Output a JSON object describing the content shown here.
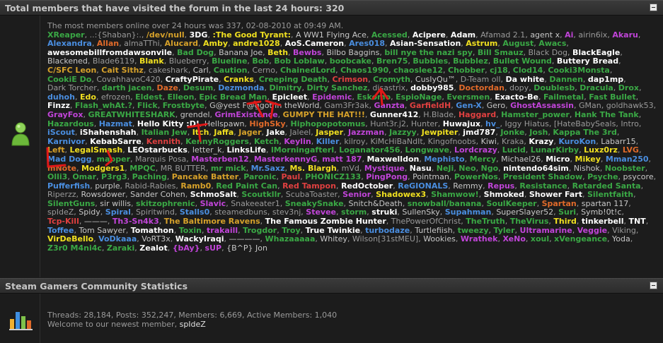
{
  "online_section": {
    "title": "Total members that have visited the forum in the last 24 hours: 320",
    "record_line": "The most members online over 24 hours was 337, 02-08-2010 at 09:49 AM.",
    "members": [
      [
        "XReaper",
        "#3aa845"
      ],
      [
        "..:{Shaban}:.",
        "#9a9a9a"
      ],
      [
        "/dev/null",
        "#d6a12a"
      ],
      [
        "3DG",
        "#ffffff"
      ],
      [
        ":The Good Tyrant:",
        "#f0e020"
      ],
      [
        "A WW1 Flying Ace",
        "#c8c8c8"
      ],
      [
        "Acessed",
        "#3aa845"
      ],
      [
        "Acipere",
        "#ffffff"
      ],
      [
        "Adam",
        "#ffffff"
      ],
      [
        "Afamad 2.1",
        "#9a9a9a"
      ],
      [
        "agent x",
        "#c8c8c8"
      ],
      [
        "Ai",
        "#c044d8"
      ],
      [
        "airin6ix",
        "#9a9a9a"
      ],
      [
        "Akaru",
        "#c044d8"
      ],
      [
        "Alexandra",
        "#4a8ee0"
      ],
      [
        "Allan",
        "#e06a2a"
      ],
      [
        "almaTThi",
        "#9a9a9a"
      ],
      [
        "Alucard",
        "#d6a12a"
      ],
      [
        "Amby",
        "#f0e020"
      ],
      [
        "andre1028",
        "#f0e020"
      ],
      [
        "AoS.Cameron",
        "#ffffff"
      ],
      [
        "Ares018",
        "#4a8ee0"
      ],
      [
        "Asian-Sensation",
        "#ffffff"
      ],
      [
        "Astrum",
        "#f0e020"
      ],
      [
        "August",
        "#3aa845"
      ],
      [
        "Awacs",
        "#3aa845"
      ],
      [
        "awesomebillfromdawsonvile",
        "#ffffff"
      ],
      [
        "Bad Dog",
        "#3aa845"
      ],
      [
        "Banana Joe",
        "#c8c8c8"
      ],
      [
        "Beth",
        "#f0e020"
      ],
      [
        "Bewbs",
        "#c044d8"
      ],
      [
        "Bilbo Baggins",
        "#c8c8c8"
      ],
      [
        "bill nye the nazi spy",
        "#3aa845"
      ],
      [
        "Bill Smauz",
        "#3aa845"
      ],
      [
        "Black Dog",
        "#9a9a9a"
      ],
      [
        "BlackEagle",
        "#ffffff"
      ],
      [
        "Blackened",
        "#c8c8c8"
      ],
      [
        "Blade6119",
        "#9a9a9a"
      ],
      [
        "Blank",
        "#f0e020"
      ],
      [
        "Blueberry",
        "#9a9a9a"
      ],
      [
        "Blueline",
        "#3aa845"
      ],
      [
        "Bob",
        "#3aa845"
      ],
      [
        "Bob Loblaw",
        "#3aa845"
      ],
      [
        "boobcake",
        "#3aa845"
      ],
      [
        "Bren75",
        "#3aa845"
      ],
      [
        "Bubbles",
        "#3aa845"
      ],
      [
        "Bubblez",
        "#3aa845"
      ],
      [
        "Bullet Wound",
        "#3aa845"
      ],
      [
        "Buttery Bread",
        "#ffffff"
      ],
      [
        "C/SFC Leon",
        "#d6a12a"
      ],
      [
        "Cait Sithz",
        "#d6a12a"
      ],
      [
        "cakeshark",
        "#9a9a9a"
      ],
      [
        "Carl",
        "#c8c8c8"
      ],
      [
        "Caution",
        "#3aa845"
      ],
      [
        "Cerno",
        "#9a9a9a"
      ],
      [
        "ChainedLord",
        "#3aa845"
      ],
      [
        "Chaos1990",
        "#3aa845"
      ],
      [
        "chaoslee12",
        "#3aa845"
      ],
      [
        "Chobber",
        "#3aa845"
      ],
      [
        "cj18",
        "#3aa845"
      ],
      [
        "Clod14",
        "#3aa845"
      ],
      [
        "Cooki3Monsta",
        "#3aa845"
      ],
      [
        "CookiE Do",
        "#3aa845"
      ],
      [
        "CovahhavoC420",
        "#9a9a9a"
      ],
      [
        "CraftyPirate",
        "#ffffff"
      ],
      [
        "Cranks",
        "#f0e020"
      ],
      [
        "Creeping Death",
        "#3aa845"
      ],
      [
        "Crimson",
        "#e04040"
      ],
      [
        "Cromyth",
        "#3aa845"
      ],
      [
        "CusIyQu™",
        "#c8c8c8"
      ],
      [
        "D-Team oll",
        "#9a9a9a"
      ],
      [
        "Da white",
        "#ffffff"
      ],
      [
        "Dannen",
        "#3aa845"
      ],
      [
        "dap1mp",
        "#ffffff"
      ],
      [
        "Dark Torcher",
        "#9a9a9a"
      ],
      [
        "darth jacen",
        "#3aa845"
      ],
      [
        "Daze",
        "#e06a2a"
      ],
      [
        "Desum",
        "#3aa845"
      ],
      [
        "Dezmonda",
        "#4a8ee0"
      ],
      [
        "Dimitry",
        "#3aa845"
      ],
      [
        "Dirty Sanchez",
        "#3aa845"
      ],
      [
        "disastrix",
        "#9a9a9a"
      ],
      [
        "dobby985",
        "#ffffff"
      ],
      [
        "Doctordan",
        "#e06a2a"
      ],
      [
        "dopy",
        "#9a9a9a"
      ],
      [
        "Doublesb",
        "#3aa845"
      ],
      [
        "Dracula",
        "#3aa845"
      ],
      [
        "Drox",
        "#3aa845"
      ],
      [
        "duhoh",
        "#4a8ee0"
      ],
      [
        "Edo",
        "#f0e020"
      ],
      [
        "efrozen",
        "#9a9a9a"
      ],
      [
        "Eldest",
        "#3aa845"
      ],
      [
        "Elleon",
        "#3aa845"
      ],
      [
        "Epic Bread Man",
        "#3aa845"
      ],
      [
        "Epicleet",
        "#ffffff"
      ],
      [
        "Epidemic",
        "#c044d8"
      ],
      [
        "Eskomo",
        "#3aa845"
      ],
      [
        "EspioNage",
        "#3aa845"
      ],
      [
        "Eversmen",
        "#3aa845"
      ],
      [
        "Exacto-Be",
        "#ffffff"
      ],
      [
        "Failmetal",
        "#3aa845"
      ],
      [
        "Fast Bullet",
        "#3aa845"
      ],
      [
        "Finzz",
        "#ffffff"
      ],
      [
        "Flash_whAt.?",
        "#3aa845"
      ],
      [
        "Flick",
        "#3aa845"
      ],
      [
        "Frostbyte",
        "#3aa845"
      ],
      [
        "G@yest F@ggot in theWorld",
        "#c8c8c8"
      ],
      [
        "Gam3Fr3ak",
        "#9a9a9a"
      ],
      [
        "Ganzta",
        "#c044d8"
      ],
      [
        "GarfieldH",
        "#e04040"
      ],
      [
        "Gen-X",
        "#4a8ee0"
      ],
      [
        "Gero",
        "#c8c8c8"
      ],
      [
        "GhostAssassin",
        "#c044d8"
      ],
      [
        "GMan",
        "#9a9a9a"
      ],
      [
        "goldhawk53",
        "#9a9a9a"
      ],
      [
        "GrayFox",
        "#c044d8"
      ],
      [
        "GREATWHITESHARK",
        "#3aa845"
      ],
      [
        "grendel",
        "#c8c8c8"
      ],
      [
        "GrimExistence",
        "#c044d8"
      ],
      [
        "GUMPY THE HAT!!!",
        "#d6a12a"
      ],
      [
        "Gunner412",
        "#ffffff"
      ],
      [
        "H.Blade",
        "#9a9a9a"
      ],
      [
        "Haggard",
        "#e04040"
      ],
      [
        "Hamster_power",
        "#3aa845"
      ],
      [
        "Hank The Tank",
        "#3aa845"
      ],
      [
        "Hazardous",
        "#3aa845"
      ],
      [
        "Hazmat",
        "#4a8ee0"
      ],
      [
        "Hello Kitty :D!",
        "#ffffff"
      ],
      [
        "Hellspawn",
        "#c8c8c8"
      ],
      [
        "HighSky",
        "#e06a2a"
      ],
      [
        "Hiphopopotomus",
        "#3aa845"
      ],
      [
        "Hunt3r.j2",
        "#9a9a9a"
      ],
      [
        "Hunter",
        "#9a9a9a"
      ],
      [
        "Huwajux",
        "#ffffff"
      ],
      [
        "hv_",
        "#4a8ee0"
      ],
      [
        "Iggy Hiatus",
        "#9a9a9a"
      ],
      [
        "[HateBabySeals",
        "#9a9a9a"
      ],
      [
        "Intro",
        "#9a9a9a"
      ],
      [
        "iScout",
        "#4a8ee0"
      ],
      [
        "iShahenshah",
        "#ffffff"
      ],
      [
        "Italian Jew",
        "#3aa845"
      ],
      [
        "Itch",
        "#f0e020"
      ],
      [
        "Jaffa",
        "#f0e020"
      ],
      [
        "Jager",
        "#d6a12a"
      ],
      [
        "Jake",
        "#ffffff"
      ],
      [
        "Jaleel",
        "#9a9a9a"
      ],
      [
        "Jasper",
        "#f0e020"
      ],
      [
        "Jazzman",
        "#c044d8"
      ],
      [
        "Jazzyy",
        "#3aa845"
      ],
      [
        "Jewpiter",
        "#f0e020"
      ],
      [
        "jmd787",
        "#ffffff"
      ],
      [
        "Jonke",
        "#3aa845"
      ],
      [
        "Josh",
        "#3aa845"
      ],
      [
        "Kappa The 3rd",
        "#3aa845"
      ],
      [
        "Karnivor",
        "#4a8ee0"
      ],
      [
        "KebabSarre",
        "#ffffff"
      ],
      [
        "Kennith",
        "#e04040"
      ],
      [
        "KennyRoggers",
        "#3aa845"
      ],
      [
        "Ketch",
        "#3aa845"
      ],
      [
        "Keylin",
        "#c044d8"
      ],
      [
        "Killer",
        "#4a8ee0"
      ],
      [
        "kilroy",
        "#9a9a9a"
      ],
      [
        "KiMcHiBaNdIt",
        "#9a9a9a"
      ],
      [
        "Kingofnoobs",
        "#9a9a9a"
      ],
      [
        "Kiwi",
        "#c8c8c8"
      ],
      [
        "Kraka",
        "#9a9a9a"
      ],
      [
        "Krazy",
        "#ffffff"
      ],
      [
        "KuroKon",
        "#4a8ee0"
      ],
      [
        "Labarr15",
        "#c8c8c8"
      ],
      [
        "Left",
        "#d6a12a"
      ],
      [
        "LegalSmash",
        "#f0e020"
      ],
      [
        "LEOstarbucks",
        "#ffffff"
      ],
      [
        "letter_k",
        "#c8c8c8"
      ],
      [
        "LinksLife",
        "#ffffff"
      ],
      [
        "lMorningafterl",
        "#3aa845"
      ],
      [
        "Loganator456",
        "#3aa845"
      ],
      [
        "Longwave",
        "#3aa845"
      ],
      [
        "Lordcrazy",
        "#c044d8"
      ],
      [
        "Lucid",
        "#3aa845"
      ],
      [
        "LunarKirby",
        "#3aa845"
      ],
      [
        "Luxz0rz",
        "#f0e020"
      ],
      [
        "LVG",
        "#e06a2a"
      ],
      [
        "Mad Dogg",
        "#4a8ee0"
      ],
      [
        "mapper",
        "#3aa845"
      ],
      [
        "Marquis Posa",
        "#9a9a9a"
      ],
      [
        "Masterben12",
        "#c044d8"
      ],
      [
        "MasterkennyG",
        "#c044d8"
      ],
      [
        "matt 187",
        "#c044d8"
      ],
      [
        "Maxwelldon",
        "#ffffff"
      ],
      [
        "Mephisto",
        "#4a8ee0"
      ],
      [
        "Mercy",
        "#3aa845"
      ],
      [
        "Michael26",
        "#c8c8c8"
      ],
      [
        "Micro",
        "#ffffff"
      ],
      [
        "Mikey",
        "#f0e020"
      ],
      [
        "Mman250",
        "#4a8ee0"
      ],
      [
        "mNote",
        "#e06a2a"
      ],
      [
        "Modgers1",
        "#f0e020"
      ],
      [
        "MPQC",
        "#3aa845"
      ],
      [
        "MR BUTTER",
        "#9a9a9a"
      ],
      [
        "mr mick",
        "#3aa845"
      ],
      [
        "Mr.Saxz",
        "#4a8ee0"
      ],
      [
        "Ms. Blargh",
        "#f0e020"
      ],
      [
        "mVd",
        "#9a9a9a"
      ],
      [
        "Mystique",
        "#c044d8"
      ],
      [
        "Nasu",
        "#ffffff"
      ],
      [
        "NeJi",
        "#3aa845"
      ],
      [
        "Neo",
        "#3aa845"
      ],
      [
        "Ngo",
        "#3aa845"
      ],
      [
        "nintendo64sim",
        "#ffffff"
      ],
      [
        "Nishok",
        "#c8c8c8"
      ],
      [
        "Noobster",
        "#3aa845"
      ],
      [
        "Olli3",
        "#3aa845"
      ],
      [
        "Omar",
        "#3aa845"
      ],
      [
        "P3rg3",
        "#3aa845"
      ],
      [
        "Paching",
        "#3aa845"
      ],
      [
        "Pancake Batter",
        "#d6a12a"
      ],
      [
        "Paronic",
        "#3aa845"
      ],
      [
        "Paul",
        "#e04040"
      ],
      [
        "PHONICZ133",
        "#3aa845"
      ],
      [
        "PingPong",
        "#c044d8"
      ],
      [
        "Pointman",
        "#c8c8c8"
      ],
      [
        "PowerNos",
        "#3aa845"
      ],
      [
        "President Shadow",
        "#3aa845"
      ],
      [
        "Psyche",
        "#3aa845"
      ],
      [
        "psycore",
        "#c8c8c8"
      ],
      [
        "Pufferfish",
        "#4a8ee0"
      ],
      [
        "purple",
        "#c8c8c8"
      ],
      [
        "Rabid-Rabies",
        "#9a9a9a"
      ],
      [
        "Ramb0",
        "#d6a12a"
      ],
      [
        "Red Paint Can",
        "#3aa845"
      ],
      [
        "Red Tampon",
        "#e04040"
      ],
      [
        "RedOctober",
        "#ffffff"
      ],
      [
        "ReGIONALS",
        "#4a8ee0"
      ],
      [
        "Remmy",
        "#c8c8c8"
      ],
      [
        "Repus",
        "#c044d8"
      ],
      [
        "Resistance",
        "#3aa845"
      ],
      [
        "Retarded Santa",
        "#3aa845"
      ],
      [
        "Riperzz",
        "#9a9a9a"
      ],
      [
        "Rowsdower",
        "#c8c8c8"
      ],
      [
        "Sander Cohen",
        "#c8c8c8"
      ],
      [
        "SchmoSalt",
        "#ffffff"
      ],
      [
        "Scoutkllr",
        "#3aa845"
      ],
      [
        "ScubaToaster",
        "#9a9a9a"
      ],
      [
        "Senior",
        "#c044d8"
      ],
      [
        "Shadowex3",
        "#f0e020"
      ],
      [
        "Shamwow!",
        "#3aa845"
      ],
      [
        "Shmoked",
        "#ffffff"
      ],
      [
        "Shower Fart",
        "#ffffff"
      ],
      [
        "Silentfaith",
        "#3aa845"
      ],
      [
        "SilentGuns",
        "#3aa845"
      ],
      [
        "sir willis",
        "#c8c8c8"
      ],
      [
        "skitzophrenic",
        "#3aa845"
      ],
      [
        "Slavic",
        "#c044d8"
      ],
      [
        "Snakeeater1",
        "#9a9a9a"
      ],
      [
        "SneakySnake",
        "#3aa845"
      ],
      [
        "Snitch&Death",
        "#c8c8c8"
      ],
      [
        "snowball/banana",
        "#3aa845"
      ],
      [
        "SoulKeeper",
        "#3aa845"
      ],
      [
        "Spartan",
        "#e06a2a"
      ],
      [
        "spartan 117",
        "#c8c8c8"
      ],
      [
        "spIdeZ",
        "#9a9a9a"
      ],
      [
        "Spidy",
        "#c8c8c8"
      ],
      [
        "Spiral",
        "#4a8ee0"
      ],
      [
        "Spiritwind",
        "#9a9a9a"
      ],
      [
        "Stalls0",
        "#4a8ee0"
      ],
      [
        "steamedbuns",
        "#9a9a9a"
      ],
      [
        "stev3nj",
        "#9a9a9a"
      ],
      [
        "Stevee",
        "#c044d8"
      ],
      [
        "storm",
        "#3aa845"
      ],
      [
        "struki",
        "#ffffff"
      ],
      [
        "SullenSky",
        "#c8c8c8"
      ],
      [
        "Supahman",
        "#4a8ee0"
      ],
      [
        "SuperSlayer52",
        "#c8c8c8"
      ],
      [
        "Suri",
        "#3aa845"
      ],
      [
        "Symb!0t!c",
        "#c8c8c8"
      ],
      [
        "Tcp-Kill",
        "#e04040"
      ],
      [
        "———",
        "#c8c8c8"
      ],
      [
        "Th3-Sn4k3",
        "#c044d8"
      ],
      [
        "The Baltimore Ravens",
        "#d6a12a"
      ],
      [
        "The Famous Zombie Hunter",
        "#ffffff"
      ],
      [
        "ThePowerOfChrist",
        "#9a9a9a"
      ],
      [
        "TheTruth",
        "#3aa845"
      ],
      [
        "TheVirus",
        "#3aa845"
      ],
      [
        "Third",
        "#f0e020"
      ],
      [
        "tinkerbell",
        "#ffffff"
      ],
      [
        "TNT",
        "#ffffff"
      ],
      [
        "Toffee",
        "#4a8ee0"
      ],
      [
        "Tom Sawyer",
        "#c8c8c8"
      ],
      [
        "Tomathon",
        "#ffffff"
      ],
      [
        "Toxin",
        "#3aa845"
      ],
      [
        "trakaill",
        "#c044d8"
      ],
      [
        "Trogdor",
        "#3aa845"
      ],
      [
        "Troy",
        "#3aa845"
      ],
      [
        "True Twinkie",
        "#ffffff"
      ],
      [
        "turbodaze",
        "#4a8ee0"
      ],
      [
        "Turtlefiish",
        "#c8c8c8"
      ],
      [
        "tweezy",
        "#3aa845"
      ],
      [
        "Tyler",
        "#3aa845"
      ],
      [
        "Ultramarine",
        "#c044d8"
      ],
      [
        "Veggie",
        "#c044d8"
      ],
      [
        "Viking",
        "#9a9a9a"
      ],
      [
        "VirDeBello",
        "#f0e020"
      ],
      [
        "VoDkaaa",
        "#4a8ee0"
      ],
      [
        "VoRT3x",
        "#c8c8c8"
      ],
      [
        "WackyIraqi",
        "#ffffff"
      ],
      [
        "————",
        "#c8c8c8"
      ],
      [
        "Whazaaaaa",
        "#3aa845"
      ],
      [
        "Whitey",
        "#c8c8c8"
      ],
      [
        "Wilson[31stMEU]",
        "#9a9a9a"
      ],
      [
        "Wookies",
        "#c8c8c8"
      ],
      [
        "Wrathek",
        "#c044d8"
      ],
      [
        "XeNo",
        "#c044d8"
      ],
      [
        "xoul",
        "#3aa845"
      ],
      [
        "xVengeance",
        "#3aa845"
      ],
      [
        "Yoda",
        "#c8c8c8"
      ],
      [
        "Z3r0 M4ni4c",
        "#3aa845"
      ],
      [
        "Zaraki",
        "#3aa845"
      ],
      [
        "Zealot",
        "#ffffff"
      ],
      [
        "{bAy}",
        "#c044d8"
      ],
      [
        "sUP",
        "#c044d8"
      ],
      [
        "{B^P} Jon",
        "#c8c8c8"
      ]
    ],
    "bold_colors": [
      "#3aa845",
      "#ffffff",
      "#d6a12a",
      "#f0e020",
      "#4a8ee0",
      "#c044d8",
      "#e04040",
      "#e06a2a"
    ]
  },
  "stats_section": {
    "title": "Steam Gamers Community Statistics",
    "stats_line": "Threads: 28,184, Posts: 352,247, Members: 6,669, Active Members: 1,040",
    "welcome_prefix": "Welcome to our newest member, ",
    "newest_member": "spIdeZ"
  }
}
